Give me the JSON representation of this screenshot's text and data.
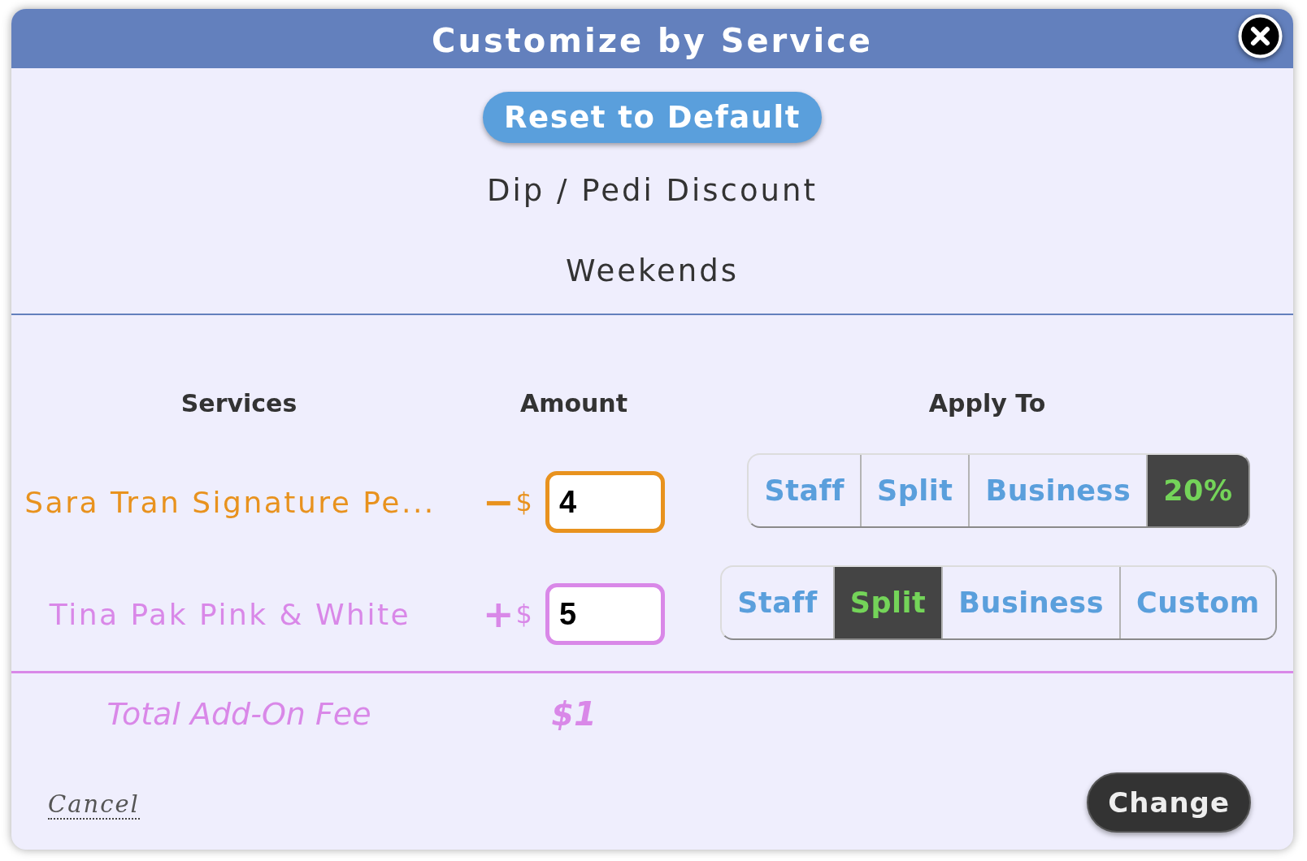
{
  "dialog": {
    "title": "Customize by Service"
  },
  "reset_button": "Reset to Default",
  "promotion": {
    "name": "Dip / Pedi Discount",
    "schedule": "Weekends"
  },
  "columns": [
    "Services",
    "Amount",
    "Apply To"
  ],
  "services": [
    {
      "name": "Sara Tran Signature Pe...",
      "color": "#e8921e",
      "sign": "−",
      "currency": "$",
      "amount": "4",
      "apply_to": [
        {
          "label": "Staff",
          "selected": false
        },
        {
          "label": "Split",
          "selected": false
        },
        {
          "label": "Business",
          "selected": false
        },
        {
          "label": "20%",
          "selected": true
        }
      ]
    },
    {
      "name": "Tina Pak Pink & White",
      "color": "#d988e8",
      "sign": "+",
      "currency": "$",
      "amount": "5",
      "apply_to": [
        {
          "label": "Staff",
          "selected": false
        },
        {
          "label": "Split",
          "selected": true
        },
        {
          "label": "Business",
          "selected": false
        },
        {
          "label": "Custom",
          "selected": false
        }
      ]
    }
  ],
  "total": {
    "label": "Total Add-On Fee",
    "value": "$1"
  },
  "footer": {
    "cancel": "Cancel",
    "change": "Change"
  }
}
